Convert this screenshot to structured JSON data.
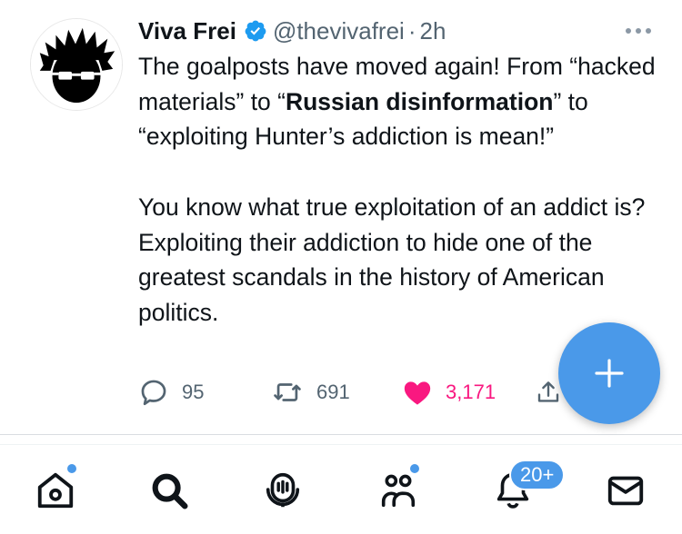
{
  "tweet": {
    "author_name": "Viva Frei",
    "verified": true,
    "handle": "@thevivafrei",
    "separator": "·",
    "time": "2h",
    "body": {
      "p1_a": "The goalposts have moved again! From “hacked materials” to “",
      "p1_bold1": "Russian disinformation",
      "p1_b": "” to “exploiting Hunter’s addiction is mean!”",
      "p2": "You know what true exploitation of an addict is? Exploiting their addiction to hide one of the greatest scandals in the history of American politics."
    },
    "actions": {
      "replies": "95",
      "retweets": "691",
      "likes": "3,171",
      "liked": true
    }
  },
  "compose_fab": {
    "icon": "plus-icon"
  },
  "tabbar": {
    "items": [
      {
        "name": "home",
        "icon": "home-icon",
        "has_dot": true
      },
      {
        "name": "search",
        "icon": "search-icon",
        "active": true
      },
      {
        "name": "spaces",
        "icon": "spaces-icon"
      },
      {
        "name": "communities",
        "icon": "communities-icon",
        "has_dot": true
      },
      {
        "name": "notifications",
        "icon": "bell-icon",
        "badge": "20+"
      },
      {
        "name": "messages",
        "icon": "mail-icon"
      }
    ]
  },
  "colors": {
    "accent": "#1d9bf0",
    "fab": "#4a99e9",
    "like": "#f91880",
    "secondary_text": "#536471",
    "text": "#0f1419"
  }
}
